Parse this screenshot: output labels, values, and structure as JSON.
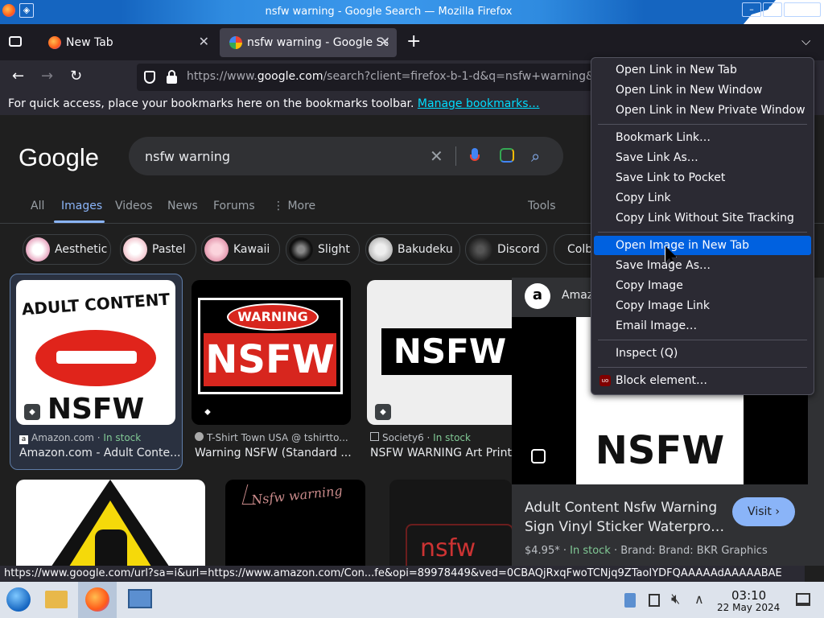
{
  "window": {
    "title": "nsfw warning - Google Search — Mozilla Firefox"
  },
  "tabs": [
    {
      "label": "New Tab"
    },
    {
      "label": "nsfw warning - Google Se"
    }
  ],
  "address_bar": {
    "prefix": "https://www.",
    "host": "google.com",
    "path": "/search?client=firefox-b-1-d&q=nsfw+warning&"
  },
  "bookmarks_bar": {
    "text": "For quick access, place your bookmarks here on the bookmarks toolbar.",
    "link": "Manage bookmarks…"
  },
  "google": {
    "logo": "Google",
    "query": "nsfw warning",
    "tabs": [
      "All",
      "Images",
      "Videos",
      "News",
      "Forums",
      "More"
    ],
    "tools": "Tools",
    "chips": [
      "Aesthetic",
      "Pastel",
      "Kawaii",
      "Slight",
      "Bakudeku",
      "Discord",
      "Colb"
    ],
    "results": [
      {
        "source": "Amazon.com",
        "stock": "In stock",
        "title": "Amazon.com - Adult Conte...",
        "img_top": "ADULT CONTENT",
        "img_bottom": "NSFW"
      },
      {
        "source": "T-Shirt Town USA @ tshirtto...",
        "stock": "",
        "title": "Warning NSFW (Standard ...",
        "img_top": "WARNING",
        "img_bottom": "NSFW"
      },
      {
        "source": "Society6",
        "stock": "In stock",
        "title": "NSFW WARNING Art Print",
        "img_top": "",
        "img_bottom": "NSFW"
      }
    ],
    "row2": {
      "handwritten": "Nsfw warning",
      "neon": "nsfw"
    },
    "panel": {
      "source": "Amaz",
      "img_bottom": "NSFW",
      "title_line1": "Adult Content Nsfw Warning",
      "title_line2": "Sign Vinyl Sticker Waterpro…",
      "price": "$4.95*",
      "stock": "In stock",
      "brand": "Brand: Brand: BKR Graphics",
      "visit": "Visit"
    }
  },
  "context_menu": {
    "group1": [
      "Open Link in New Tab",
      "Open Link in New Window",
      "Open Link in New Private Window"
    ],
    "group2": [
      "Bookmark Link…",
      "Save Link As…",
      "Save Link to Pocket",
      "Copy Link",
      "Copy Link Without Site Tracking"
    ],
    "group3": [
      "Open Image in New Tab",
      "Save Image As…",
      "Copy Image",
      "Copy Image Link",
      "Email Image…"
    ],
    "group4": [
      "Inspect (Q)"
    ],
    "group5": [
      "Block element…"
    ],
    "highlighted": "Open Image in New Tab"
  },
  "status_bar": {
    "url": "https://www.google.com/url?sa=i&url=https://www.amazon.com/Con...fe&opi=89978449&ved=0CBAQjRxqFwoTCNjq9ZTaoIYDFQAAAAAdAAAAABAE"
  },
  "taskbar": {
    "time": "03:10",
    "date": "22 May 2024"
  },
  "colors": {
    "accent": "#0061e0",
    "google_link": "#8ab4f8",
    "in_stock": "#81c995",
    "taskbar": "#dde3ec"
  }
}
